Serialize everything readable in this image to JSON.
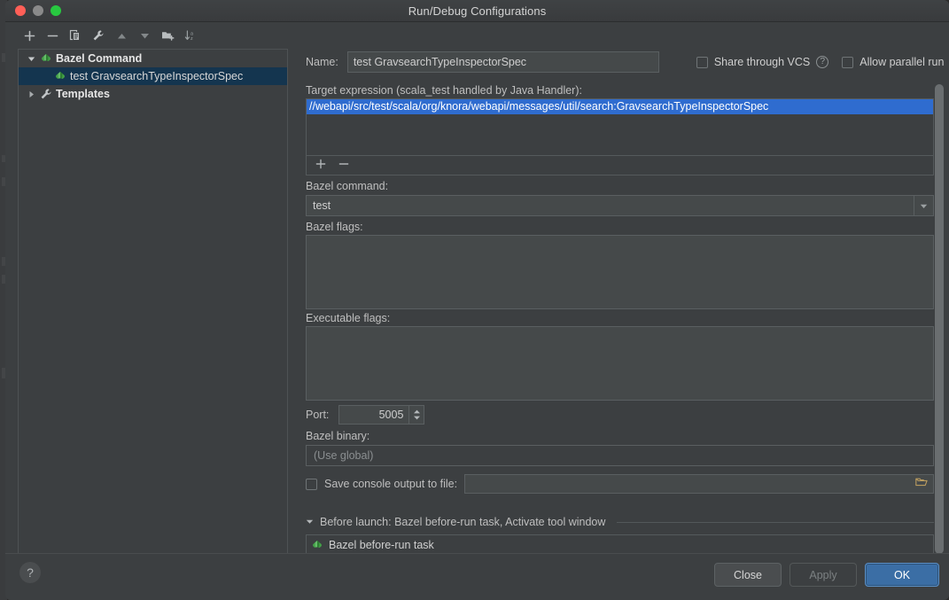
{
  "window": {
    "title": "Run/Debug Configurations",
    "traffic_lights": [
      "close",
      "minimize",
      "zoom"
    ]
  },
  "left_panel": {
    "toolbar": [
      {
        "name": "add-configuration-button",
        "icon": "plus-icon"
      },
      {
        "name": "remove-configuration-button",
        "icon": "minus-icon"
      },
      {
        "name": "copy-configuration-button",
        "icon": "copy-icon"
      },
      {
        "name": "edit-templates-button",
        "icon": "wrench-icon"
      },
      {
        "name": "move-up-button",
        "icon": "triangle-up-icon"
      },
      {
        "name": "move-down-button",
        "icon": "triangle-down-icon"
      },
      {
        "name": "new-folder-button",
        "icon": "folder-add-icon"
      },
      {
        "name": "sort-configurations-button",
        "icon": "sort-az-icon"
      }
    ],
    "tree": [
      {
        "label": "Bazel Command",
        "icon": "bazel-leaf-icon",
        "expanded": true,
        "level": 0,
        "selected": false,
        "bold": true
      },
      {
        "label": "test GravsearchTypeInspectorSpec",
        "icon": "bazel-leaf-icon",
        "expanded": null,
        "level": 1,
        "selected": true,
        "bold": false
      },
      {
        "label": "Templates",
        "icon": "wrench-icon",
        "expanded": false,
        "level": 0,
        "selected": false,
        "bold": true
      }
    ]
  },
  "form": {
    "name_label": "Name:",
    "name_value": "test GravsearchTypeInspectorSpec",
    "share_vcs_label": "Share through VCS",
    "share_vcs_checked": false,
    "share_vcs_help": "?",
    "allow_parallel_label": "Allow parallel run",
    "allow_parallel_checked": false,
    "target_label": "Target expression (scala_test handled by Java Handler):",
    "target_value": "//webapi/src/test/scala/org/knora/webapi/messages/util/search:GravsearchTypeInspectorSpec",
    "target_add_icon": "plus-icon",
    "target_remove_icon": "minus-icon",
    "bazel_command_label": "Bazel command:",
    "bazel_command_value": "test",
    "bazel_command_options": [
      "test"
    ],
    "bazel_flags_label": "Bazel flags:",
    "bazel_flags_value": "",
    "executable_flags_label": "Executable flags:",
    "executable_flags_value": "",
    "port_label": "Port:",
    "port_value": "5005",
    "bazel_binary_label": "Bazel binary:",
    "bazel_binary_placeholder": "(Use global)",
    "bazel_binary_value": "",
    "save_console_label": "Save console output to file:",
    "save_console_checked": false,
    "save_console_value": "",
    "save_console_browse_icon": "folder-icon",
    "before_launch_header": "Before launch: Bazel before-run task, Activate tool window",
    "before_launch_expanded": true,
    "before_launch_tasks": [
      {
        "label": "Bazel before-run task",
        "icon": "bazel-leaf-icon"
      }
    ],
    "before_launch_toolbar": [
      {
        "name": "add-task-button",
        "icon": "plus-icon",
        "enabled": true
      },
      {
        "name": "remove-task-button",
        "icon": "minus-icon",
        "enabled": false
      },
      {
        "name": "edit-task-button",
        "icon": "pencil-icon",
        "enabled": false
      },
      {
        "name": "task-move-up-button",
        "icon": "triangle-up-icon",
        "enabled": false
      },
      {
        "name": "task-move-down-button",
        "icon": "triangle-down-icon",
        "enabled": false
      }
    ]
  },
  "footer": {
    "help_label": "?",
    "close_label": "Close",
    "apply_label": "Apply",
    "apply_enabled": false,
    "ok_label": "OK"
  },
  "colors": {
    "window_bg": "#3c3f41",
    "field_bg": "#45494a",
    "selection_blue": "#2f6ccf",
    "tree_selection": "#14354f",
    "accent_button": "#3b6ea5",
    "bazel_green": "#5ec45e",
    "text": "#cfcfcf"
  }
}
